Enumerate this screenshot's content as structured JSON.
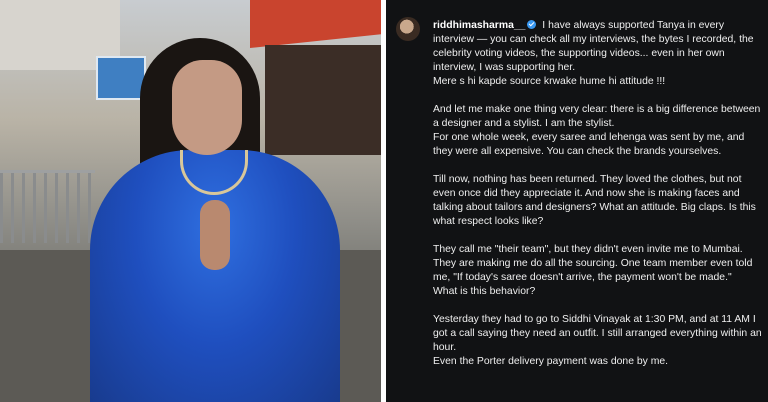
{
  "post": {
    "username": "riddhimasharma__",
    "intro": "I have always supported Tanya in every interview — you can check all my interviews, the bytes I recorded, the celebrity voting videos, the supporting videos... even in her own interview, I was supporting her.",
    "paragraphs": [
      {
        "lines": [
          "Mere s hi kapde source krwake hume hi attitude !!!"
        ]
      },
      {
        "lines": [
          "And let me make one thing very clear: there is a big difference between a designer and a stylist. I am the stylist.",
          "For one whole week, every saree and lehenga was sent by me, and they were all expensive. You can check the brands yourselves."
        ]
      },
      {
        "lines": [
          "Till now, nothing has been returned. They loved the clothes, but not even once did they appreciate it. And now she is making faces and talking about tailors and designers? What an attitude. Big claps. Is this what respect looks like?"
        ]
      },
      {
        "lines": [
          "They call me \"their team\", but they didn't even invite me to Mumbai.",
          "They are making me do all the sourcing. One team member even told me, \"If today's saree doesn't arrive, the payment won't be made.\"",
          "What is this behavior?"
        ]
      },
      {
        "lines": [
          "Yesterday they had to go to Siddhi Vinayak at 1:30 PM, and at 11 AM I got a call saying they need an outfit. I still arranged everything within an hour.",
          "Even the Porter delivery payment was done by me."
        ]
      }
    ]
  },
  "colors": {
    "post_background": "#111214",
    "text": "#efefef",
    "verified_badge": "#3897f0"
  },
  "icons": {
    "verified": "verified-badge-icon"
  }
}
